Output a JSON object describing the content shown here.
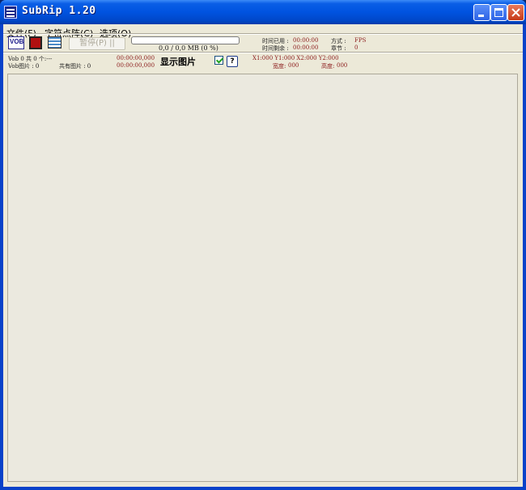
{
  "window": {
    "title": "SubRip 1.20"
  },
  "menu": [
    {
      "label": "文件(F)"
    },
    {
      "label": "字符点阵(C)"
    },
    {
      "label": "选项(O)"
    }
  ],
  "toolbar": {
    "vob_icon_text": "VOB",
    "pause_label": "暂停(P) ||",
    "progress_text": "0,0 / 0,0 MB (0 %)",
    "progress_percent": 0,
    "time_elapsed_label": "时间已用 :",
    "time_elapsed_value": "00:00:00",
    "time_remaining_label": "时间剩余 :",
    "time_remaining_value": "00:00:00",
    "mode_label": "方式 :",
    "mode_value": "FPS",
    "chapter_label": "章节 :",
    "chapter_value": "0"
  },
  "status": {
    "vob_line": "Vob 0  共 0 个:---",
    "vob_images": "Vob图片 : 0",
    "total_images": "共有图片 : 0",
    "time1": "00:00:00,000",
    "time2": "00:00:00,000",
    "show_image_label": "显示图片",
    "show_image_checked": true,
    "help_label": "?",
    "coords": "X1:000  Y1:000  X2:000  Y2:000",
    "width_label": "宽度:",
    "width_value": "000",
    "height_label": "高度:",
    "height_value": "000"
  },
  "colors": {
    "title_bar": "#0053e0",
    "close_button": "#c63a18",
    "client_bg": "#ece9d8",
    "value_red": "#8b1a1a"
  }
}
